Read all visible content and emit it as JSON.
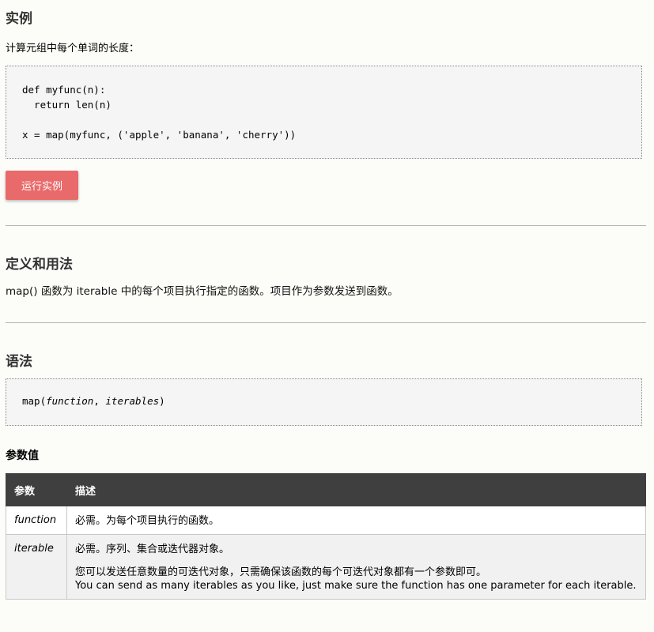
{
  "example": {
    "title": "实例",
    "description": "计算元组中每个单词的长度：",
    "code_lines": [
      "def myfunc(n):",
      "  return len(n)",
      "x = map(myfunc, ('apple', 'banana', 'cherry'))"
    ],
    "run_button_label": "运行实例",
    "accent_color": "#e96a6a"
  },
  "definition": {
    "title": "定义和用法",
    "text": "map() 函数为 iterable 中的每个项目执行指定的函数。项目作为参数发送到函数。"
  },
  "syntax": {
    "title": "语法",
    "prefix": "map(",
    "arg1": "function",
    "sep": ", ",
    "arg2": "iterables",
    "suffix": ")"
  },
  "parameters": {
    "title": "参数值",
    "headers": [
      "参数",
      "描述"
    ],
    "rows": [
      {
        "name": "function",
        "desc": [
          "必需。为每个项目执行的函数。"
        ]
      },
      {
        "name": "iterable",
        "desc": [
          "必需。序列、集合或迭代器对象。",
          "您可以发送任意数量的可迭代对象，只需确保该函数的每个可迭代对象都有一个参数即可。",
          "You can send as many iterables as you like, just make sure the function has one parameter for each iterable."
        ]
      }
    ]
  }
}
